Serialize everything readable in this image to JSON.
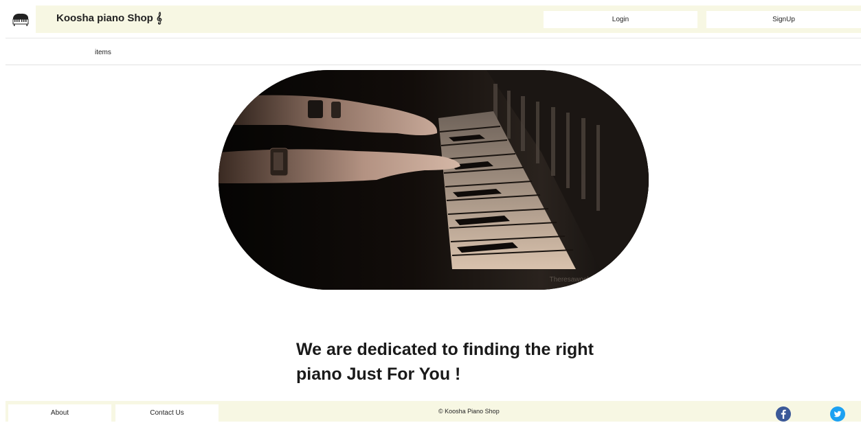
{
  "header": {
    "brand_title": "Koosha piano Shop 𝄞",
    "logo_icon": "piano-icon",
    "login_label": "Login",
    "signup_label": "SignUp"
  },
  "nav": {
    "items": [
      {
        "label": "items"
      }
    ]
  },
  "hero": {
    "image_watermark": "Theresawocketinmypocket"
  },
  "main": {
    "tagline": "We are dedicated to finding the right piano Just For You !"
  },
  "footer": {
    "about_label": "About",
    "contact_label": "Contact Us",
    "copyright": "© Koosha Piano Shop",
    "social": [
      {
        "icon": "facebook-icon",
        "color": "#3b5998"
      },
      {
        "icon": "twitter-icon",
        "color": "#1da1f2"
      }
    ]
  },
  "colors": {
    "header_bg": "#f7f7e3",
    "footer_bg": "#f7f7e3",
    "button_bg": "#ffffff"
  }
}
